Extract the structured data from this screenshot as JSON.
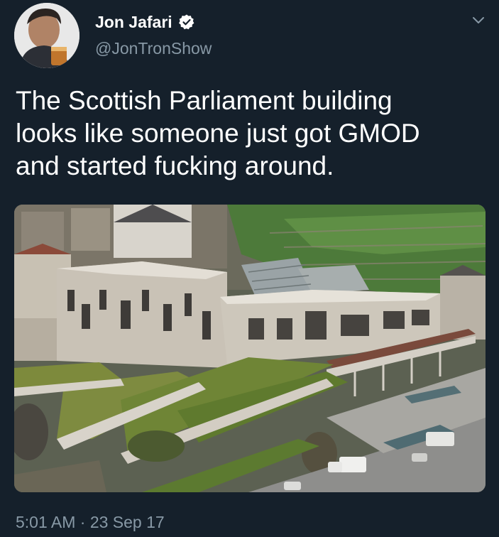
{
  "author": {
    "display_name": "Jon Jafari",
    "handle": "@JonTronShow",
    "verified": true,
    "avatar_icon": "user-avatar"
  },
  "tweet": {
    "text": "The Scottish Parliament building\nlooks like someone just got GMOD\nand started fucking around.",
    "timestamp": "5:01 AM · 23 Sep 17"
  },
  "media": {
    "type": "photo"
  },
  "icons": {
    "verified": "verified-badge-icon",
    "menu": "chevron-down-icon"
  },
  "colors": {
    "background": "#15202b",
    "primary_text": "#ffffff",
    "secondary_text": "#8899a6"
  }
}
